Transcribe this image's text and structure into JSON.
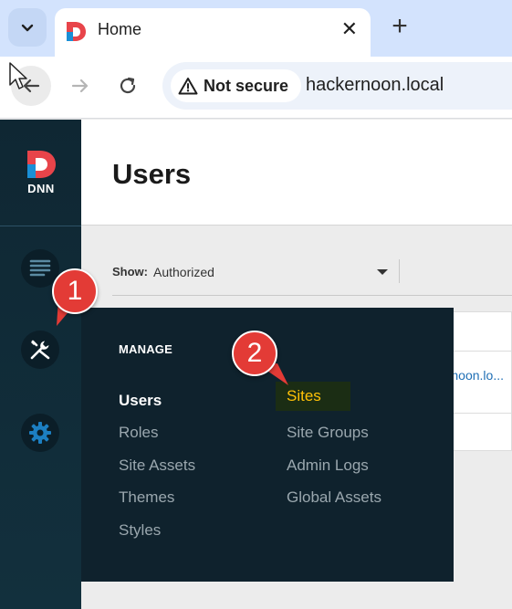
{
  "browser": {
    "tab_title": "Home",
    "new_tab_symbol": "+",
    "close_symbol": "✕",
    "security_label": "Not secure",
    "url": "hackernoon.local"
  },
  "dnn": {
    "logo_text": "DNN"
  },
  "page": {
    "title": "Users",
    "filter": {
      "label": "Show:",
      "value": "Authorized"
    },
    "email_fragment": "noon.lo..."
  },
  "flyout": {
    "heading": "MANAGE",
    "left_items": [
      "Users",
      "Roles",
      "Site Assets",
      "Themes",
      "Styles"
    ],
    "right_items": [
      "Sites",
      "Site Groups",
      "Admin Logs",
      "Global Assets"
    ]
  },
  "markers": [
    "1",
    "2"
  ],
  "colors": {
    "marker_red": "#e33b36",
    "sidebar_bg": "#12303d",
    "flyout_bg": "#0f222d",
    "sites_highlight": "#ffc107",
    "dnn_red": "#e8444a",
    "dnn_blue": "#1a8fd6"
  }
}
